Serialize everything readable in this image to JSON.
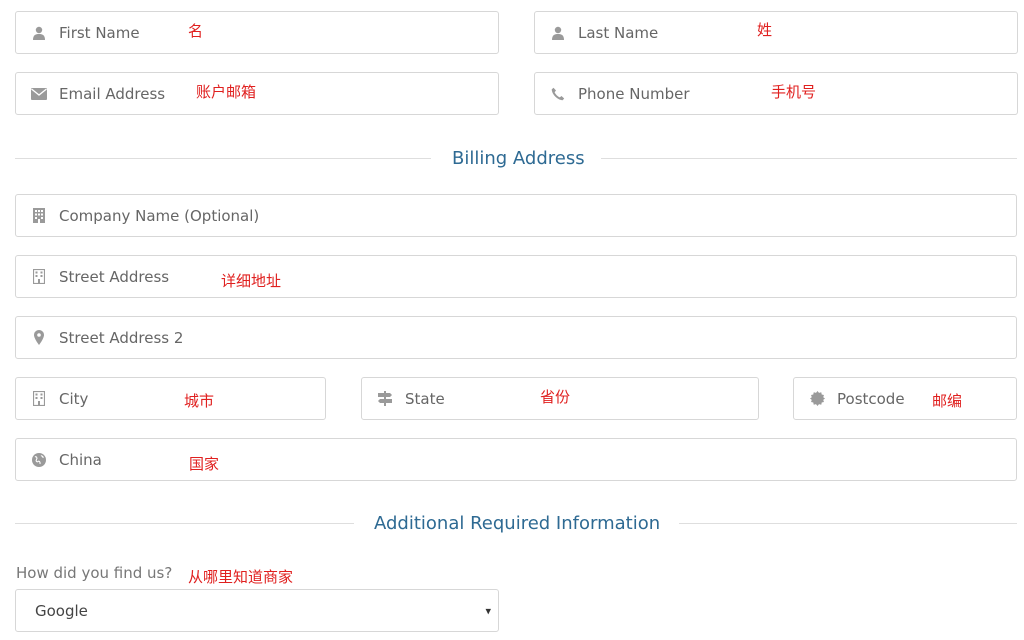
{
  "contact": {
    "first_name": {
      "placeholder": "First Name",
      "annotation": "名",
      "icon": "user-icon"
    },
    "last_name": {
      "placeholder": "Last Name",
      "annotation": "姓",
      "icon": "user-icon"
    },
    "email": {
      "placeholder": "Email Address",
      "annotation": "账户邮箱",
      "icon": "envelope-icon"
    },
    "phone": {
      "placeholder": "Phone Number",
      "annotation": "手机号",
      "icon": "phone-icon"
    }
  },
  "billing": {
    "heading": "Billing Address",
    "company": {
      "placeholder": "Company Name (Optional)",
      "icon": "building-icon"
    },
    "street": {
      "placeholder": "Street Address",
      "annotation": "详细地址",
      "icon": "building-icon"
    },
    "street2": {
      "placeholder": "Street Address 2",
      "icon": "map-marker-icon"
    },
    "city": {
      "placeholder": "City",
      "annotation": "城市",
      "icon": "building-icon"
    },
    "state": {
      "placeholder": "State",
      "annotation": "省份",
      "icon": "signpost-icon"
    },
    "postcode": {
      "placeholder": "Postcode",
      "annotation": "邮编",
      "icon": "certificate-icon"
    },
    "country": {
      "value": "China",
      "annotation": "国家",
      "icon": "globe-icon"
    }
  },
  "additional": {
    "heading": "Additional Required Information",
    "question": "How did you find us?",
    "question_annotation": "从哪里知道商家",
    "selected": "Google",
    "caret": "▾"
  },
  "colors": {
    "annotation": "#e0201f",
    "heading": "#2e6a93",
    "border": "#d7d7d7",
    "icon": "#9a9a9a"
  }
}
